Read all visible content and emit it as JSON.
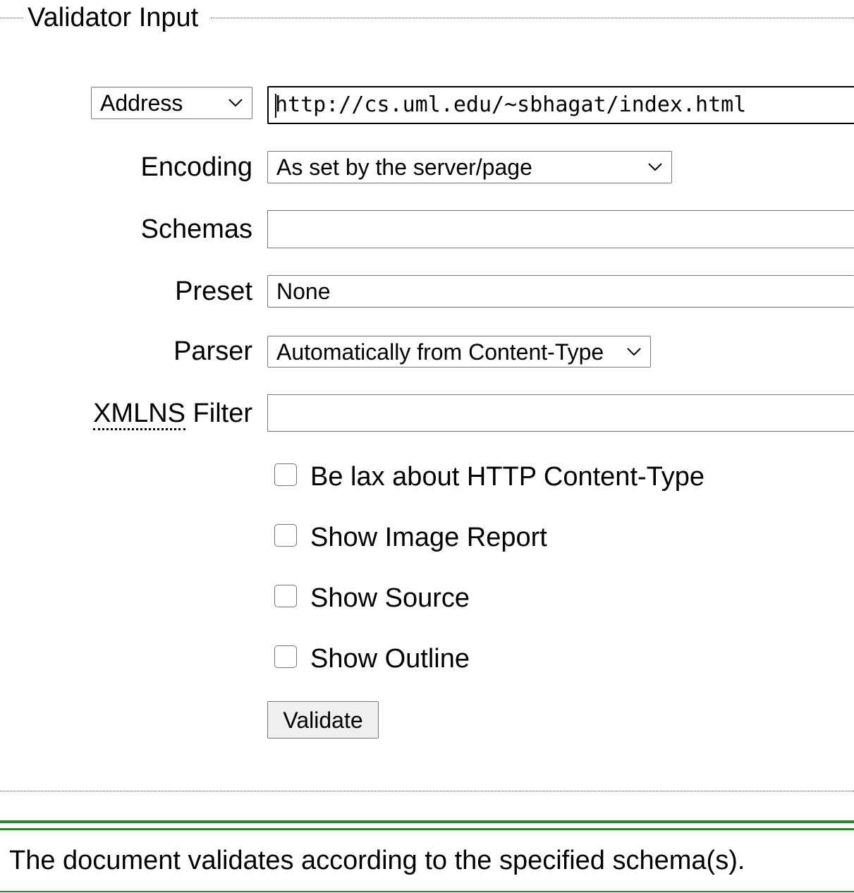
{
  "fieldset": {
    "legend": "Validator Input"
  },
  "input_source": {
    "selected": "Address",
    "url_value": "http://cs.uml.edu/~sbhagat/index.html"
  },
  "encoding": {
    "label": "Encoding",
    "selected": "As set by the server/page"
  },
  "schemas": {
    "label": "Schemas",
    "value": ""
  },
  "preset": {
    "label": "Preset",
    "value": "None"
  },
  "parser": {
    "label": "Parser",
    "selected": "Automatically from Content-Type"
  },
  "xmlns_filter": {
    "label_abbr": "XMLNS",
    "label_rest": " Filter",
    "value": ""
  },
  "options": [
    {
      "label": "Be lax about HTTP Content-Type",
      "checked": false
    },
    {
      "label": "Show Image Report",
      "checked": false
    },
    {
      "label": "Show Source",
      "checked": false
    },
    {
      "label": "Show Outline",
      "checked": false
    }
  ],
  "validate_button": {
    "label": "Validate"
  },
  "result": {
    "message": "The document validates according to the specified schema(s)."
  },
  "colors": {
    "success_line": "#228b22",
    "field_border": "#767676",
    "button_bg": "#efefef"
  },
  "icons": {
    "dropdown": "chevron-down-icon"
  }
}
